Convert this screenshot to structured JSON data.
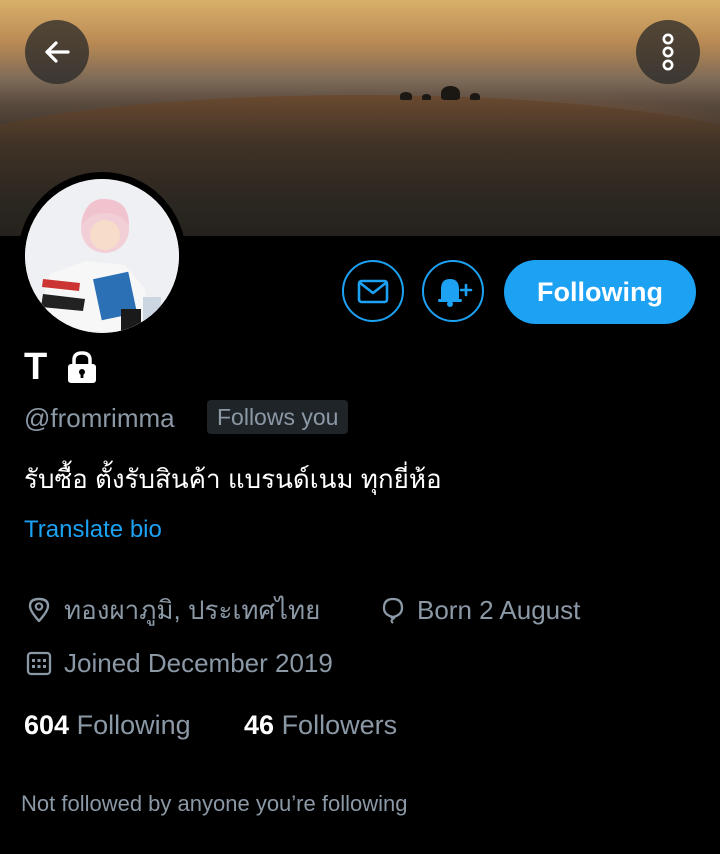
{
  "header": {
    "back_icon": "arrow-left-icon",
    "more_icon": "vertical-dots-icon"
  },
  "profile": {
    "name": "T",
    "handle": "@fromrimma",
    "follows_you_label": "Follows you",
    "bio": "รับซื้อ ตั้งรับสินค้า แบรนด์เนม ทุกยี่ห้อ",
    "translate_label": "Translate bio",
    "location": "ทองผาภูมิ, ประเทศไทย",
    "birthday": "Born 2 August",
    "joined": "Joined December 2019",
    "following_count": "604",
    "following_label": "Following",
    "followers_count": "46",
    "followers_label": "Followers",
    "not_followed_text": "Not followed by anyone you’re following"
  },
  "actions": {
    "message_icon": "envelope-icon",
    "notify_icon": "bell-plus-icon",
    "follow_button_label": "Following"
  },
  "colors": {
    "accent": "#1da1f2",
    "background": "#000000",
    "secondary_text": "#8b98a5"
  }
}
